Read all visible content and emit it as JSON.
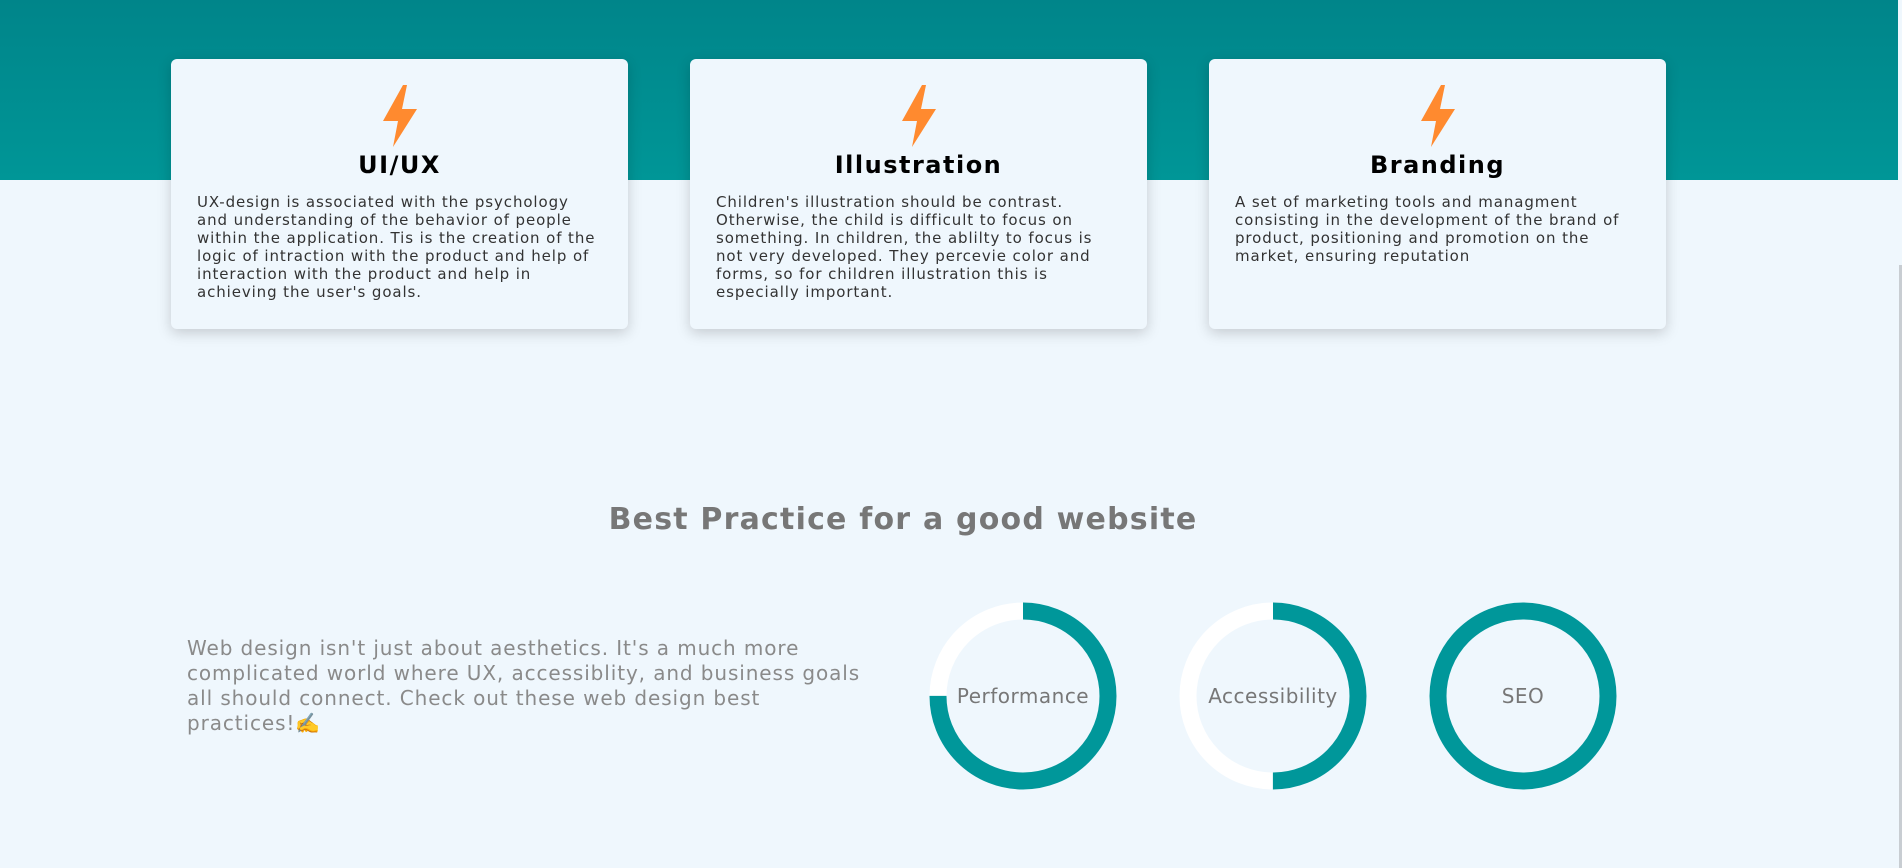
{
  "theme": {
    "accent": "#00979a",
    "background": "#eff7fd",
    "icon_color": "#ff8a2f"
  },
  "services": [
    {
      "icon": "lightning-bolt-icon",
      "title": "UI/UX",
      "description": "UX-design is associated with the psychology and understanding of the behavior of people within the application. Tis is the creation of the logic of intraction with the product and help of interaction with the product and help in achieving the user's goals."
    },
    {
      "icon": "lightning-bolt-icon",
      "title": "Illustration",
      "description": "Children's illustration should be contrast. Otherwise, the child is difficult to focus on something. In children, the ablilty to focus is not very developed. They percevie color and forms, so for children illustration this is especially important."
    },
    {
      "icon": "lightning-bolt-icon",
      "title": "Branding",
      "description": "A set of marketing tools and managment consisting in the development of the brand of product, positioning and promotion on the market, ensuring reputation"
    }
  ],
  "best_practice": {
    "title": "Best Practice for a good website",
    "intro": "Web design isn't just about aesthetics. It's a much more complicated world where UX, accessiblity, and business goals all should connect. Check out these web design best practices!✍️",
    "metrics": [
      {
        "label": "Performance",
        "progress": 0.75
      },
      {
        "label": "Accessibility",
        "progress": 0.5
      },
      {
        "label": "SEO",
        "progress": 1.0
      }
    ]
  }
}
